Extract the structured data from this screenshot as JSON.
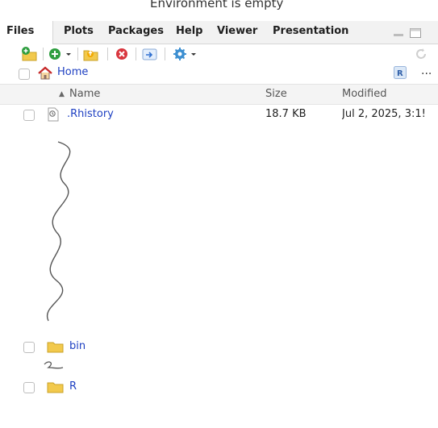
{
  "environment": {
    "message": "Environment is empty"
  },
  "tabs": [
    {
      "label": "Files",
      "active": true
    },
    {
      "label": "Plots",
      "active": false
    },
    {
      "label": "Packages",
      "active": false
    },
    {
      "label": "Help",
      "active": false
    },
    {
      "label": "Viewer",
      "active": false
    },
    {
      "label": "Presentation",
      "active": false
    }
  ],
  "toolbar": {
    "icons": [
      "new-folder-icon",
      "new-blank-file-icon",
      "upload-icon",
      "delete-icon",
      "rename-icon",
      "more-gear-icon",
      "refresh-icon"
    ]
  },
  "path": {
    "home_label": "Home",
    "more": "..."
  },
  "columns": {
    "sort_arrow": "▲",
    "name": "Name",
    "size": "Size",
    "modified": "Modified"
  },
  "files": [
    {
      "name": ".Rhistory",
      "size": "18.7 KB",
      "modified": "Jul 2, 2025, 3:1!",
      "type": "file"
    },
    {
      "name": "bin",
      "size": "",
      "modified": "",
      "type": "folder"
    },
    {
      "name": "R",
      "size": "",
      "modified": "",
      "type": "folder"
    }
  ],
  "colors": {
    "link": "#1d3fc2",
    "folder": "#f2c94c",
    "delete": "#d9363e",
    "add": "#2e9e3f"
  }
}
